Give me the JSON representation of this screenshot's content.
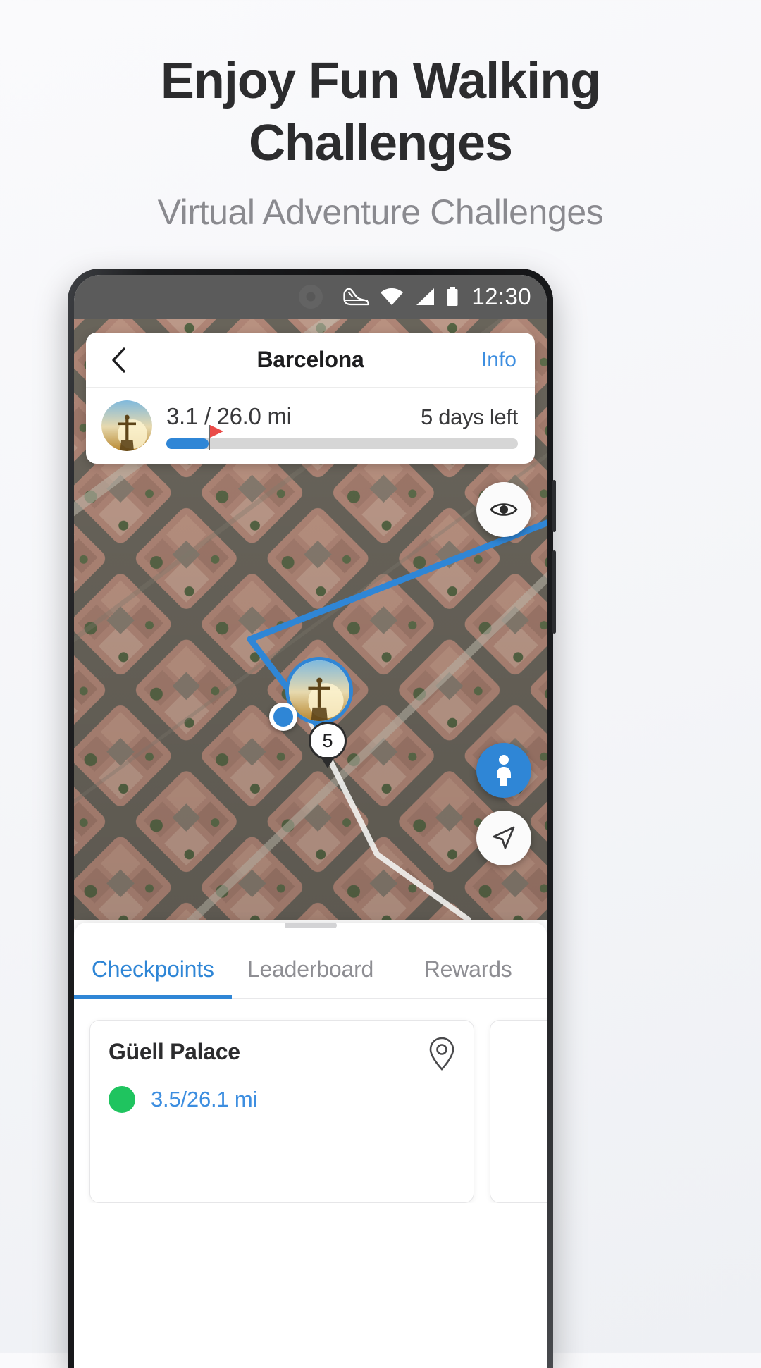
{
  "promo": {
    "headline_line1": "Enjoy Fun Walking",
    "headline_line2": "Challenges",
    "subtitle": "Virtual Adventure Challenges"
  },
  "status_bar": {
    "time": "12:30",
    "icons": [
      "shoe-icon",
      "wifi-icon",
      "cellular-signal-icon",
      "battery-icon"
    ]
  },
  "header": {
    "back_label": "‹",
    "title": "Barcelona",
    "info_label": "Info"
  },
  "progress": {
    "avatar": "christ-the-redeemer-avatar",
    "distance": "3.1 / 26.0 mi",
    "days_left": "5 days left",
    "percent": 12
  },
  "map": {
    "marker_avatar": "christ-the-redeemer-marker",
    "mile_marker": "5",
    "buttons": [
      {
        "name": "eye-visibility-button",
        "icon": "eye-icon"
      },
      {
        "name": "street-view-pegman-button",
        "icon": "pegman-icon"
      },
      {
        "name": "my-location-button",
        "icon": "navigation-arrow-icon"
      }
    ]
  },
  "sheet": {
    "tabs": [
      {
        "label": "Checkpoints",
        "active": true
      },
      {
        "label": "Leaderboard",
        "active": false
      },
      {
        "label": "Rewards",
        "active": false
      }
    ],
    "checkpoints": [
      {
        "name": "Güell Palace",
        "distance": "3.5/26.1 mi",
        "status_color": "#1fc45f"
      }
    ]
  },
  "colors": {
    "accent_blue": "#2f86d6",
    "link_blue": "#3d8ee0",
    "success_green": "#1fc45f",
    "flag_red": "#ea4b48",
    "headline": "#2c2c2e",
    "subtitle": "#8a8a8f"
  }
}
